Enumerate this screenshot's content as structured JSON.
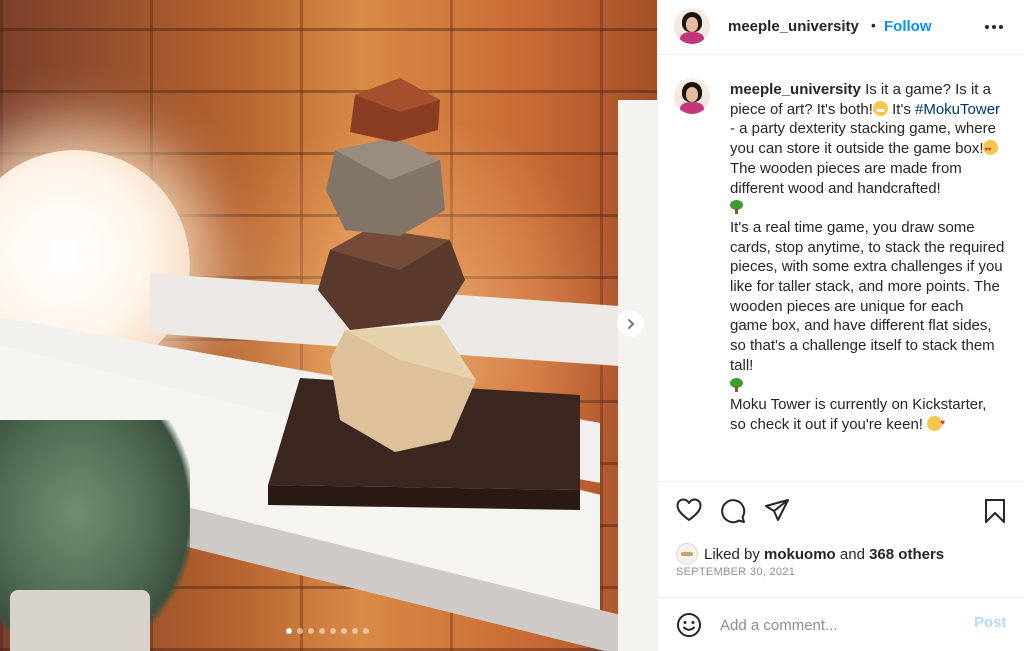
{
  "post": {
    "username": "meeple_university",
    "separator": "•",
    "follow_label": "Follow",
    "caption": {
      "username": "meeple_university",
      "part1": "Is it a game? Is it a piece of art? It's both!",
      "part2": " It's ",
      "hashtag": "#MokuTower",
      "part3": " - a party dexterity stacking game, where you can store it outside the game box!",
      "part4": " The wooden pieces are made from different wood and handcrafted!",
      "part5": "It's a real time game, you draw some cards, stop anytime, to stack the required pieces, with some extra challenges if you like for taller stack, and more points. The wooden pieces are unique for each game box, and have different flat sides, so that's a challenge itself to stack them tall!",
      "part6": "Moku Tower is currently on Kickstarter, so check it out if you're keen!"
    },
    "likes": {
      "prefix": "Liked by",
      "user": "mokuomo",
      "middle": "and",
      "others": "368 others"
    },
    "date": "SEPTEMBER 30, 2021",
    "comment_placeholder": "Add a comment...",
    "post_label": "Post"
  },
  "carousel": {
    "total_images": 8,
    "current_index": 1
  },
  "icons": {
    "like": "heart-icon",
    "comment": "comment-icon",
    "share": "send-icon",
    "save": "bookmark-icon",
    "emoji": "smiley-icon",
    "next": "chevron-right-icon",
    "more": "more-options-icon"
  },
  "colors": {
    "link_blue": "#0095f6",
    "hashtag": "#00376b",
    "text": "#262626",
    "muted": "#8e8e8e"
  }
}
